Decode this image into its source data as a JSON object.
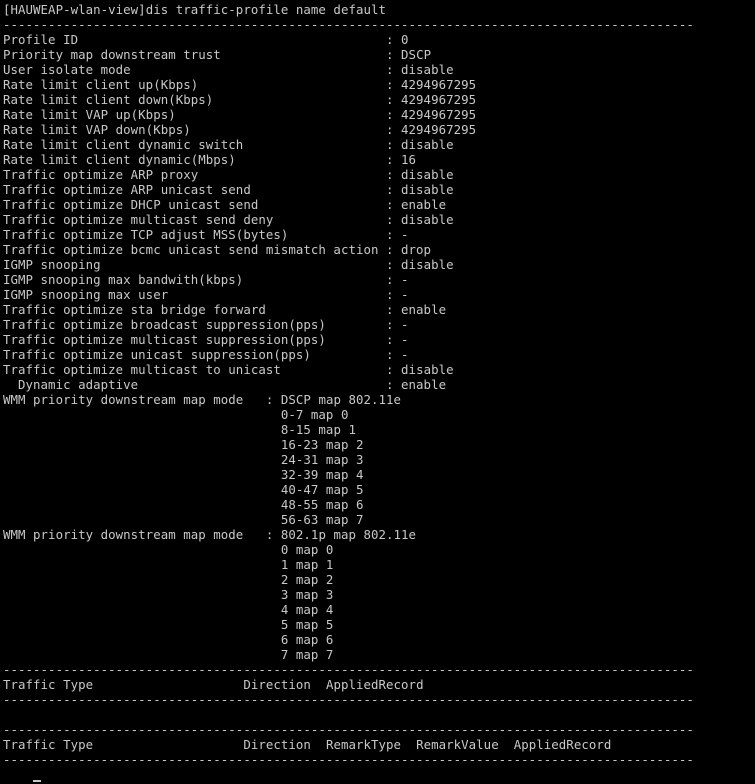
{
  "prompt": "[HAUWEAP-wlan-view]",
  "command": "dis traffic-profile name default",
  "separator": "--------------------------------------------------------------------------------------------",
  "profile_rows": [
    {
      "key": "Profile ID",
      "value": "0"
    },
    {
      "key": "Priority map downstream trust",
      "value": "DSCP"
    },
    {
      "key": "User isolate mode",
      "value": "disable"
    },
    {
      "key": "Rate limit client up(Kbps)",
      "value": "4294967295"
    },
    {
      "key": "Rate limit client down(Kbps)",
      "value": "4294967295"
    },
    {
      "key": "Rate limit VAP up(Kbps)",
      "value": "4294967295"
    },
    {
      "key": "Rate limit VAP down(Kbps)",
      "value": "4294967295"
    },
    {
      "key": "Rate limit client dynamic switch",
      "value": "disable"
    },
    {
      "key": "Rate limit client dynamic(Mbps)",
      "value": "16"
    },
    {
      "key": "Traffic optimize ARP proxy",
      "value": "disable"
    },
    {
      "key": "Traffic optimize ARP unicast send",
      "value": "disable"
    },
    {
      "key": "Traffic optimize DHCP unicast send",
      "value": "enable"
    },
    {
      "key": "Traffic optimize multicast send deny",
      "value": "disable"
    },
    {
      "key": "Traffic optimize TCP adjust MSS(bytes)",
      "value": "-"
    },
    {
      "key": "Traffic optimize bcmc unicast send mismatch action",
      "value": "drop"
    },
    {
      "key": "IGMP snooping",
      "value": "disable"
    },
    {
      "key": "IGMP snooping max bandwith(kbps)",
      "value": "-"
    },
    {
      "key": "IGMP snooping max user",
      "value": "-"
    },
    {
      "key": "Traffic optimize sta bridge forward",
      "value": "enable"
    },
    {
      "key": "Traffic optimize broadcast suppression(pps)",
      "value": "-"
    },
    {
      "key": "Traffic optimize multicast suppression(pps)",
      "value": "-"
    },
    {
      "key": "Traffic optimize unicast suppression(pps)",
      "value": "-"
    },
    {
      "key": "Traffic optimize multicast to unicast",
      "value": "disable"
    },
    {
      "key": "  Dynamic adaptive",
      "value": "enable"
    }
  ],
  "wmm_maps": [
    {
      "key": "WMM priority downstream map mode",
      "mode": "DSCP map 802.11e",
      "entries": [
        "0-7 map 0",
        "8-15 map 1",
        "16-23 map 2",
        "24-31 map 3",
        "32-39 map 4",
        "40-47 map 5",
        "48-55 map 6",
        "56-63 map 7"
      ]
    },
    {
      "key": "WMM priority downstream map mode",
      "mode": "802.1p map 802.11e",
      "entries": [
        "0 map 0",
        "1 map 1",
        "2 map 2",
        "3 map 3",
        "4 map 4",
        "5 map 5",
        "6 map 6",
        "7 map 7"
      ]
    }
  ],
  "table1_headers": [
    "Traffic Type",
    "Direction",
    "AppliedRecord"
  ],
  "table2_headers": [
    "Traffic Type",
    "Direction",
    "RemarkType",
    "RemarkValue",
    "AppliedRecord"
  ]
}
